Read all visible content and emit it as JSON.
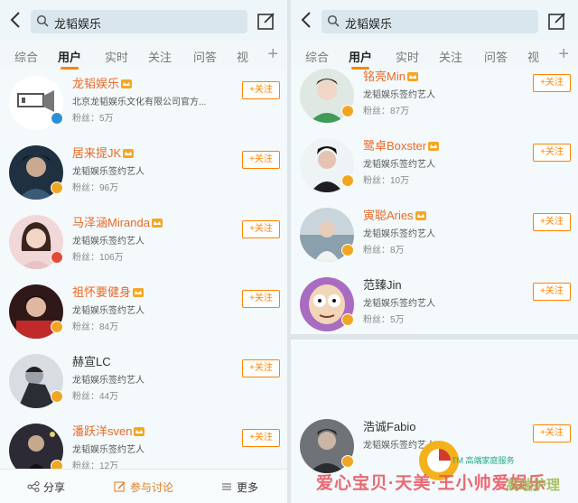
{
  "search": {
    "query": "龙韬娱乐"
  },
  "tabs_left": [
    "综合",
    "用户",
    "实时",
    "关注",
    "问答",
    "视"
  ],
  "tabs_right": [
    "综合",
    "用户",
    "实时",
    "关注",
    "问答",
    "视"
  ],
  "colors": {
    "accent": "#ff8200",
    "name_orange": "#e86b2a",
    "verified_blue": "#2b8fd8",
    "verified_gold": "#f1a623",
    "verified_red": "#e24b3a"
  },
  "follow_label": "+关注",
  "left_users": [
    {
      "name": "龙韬娱乐",
      "crown": true,
      "desc": "北京龙韬娱乐文化有限公司官方...",
      "fans": "粉丝：5万",
      "badge": "blue",
      "avatar": "logo"
    },
    {
      "name": "居来提JK",
      "crown": true,
      "desc": "龙韬娱乐签约艺人",
      "fans": "粉丝：96万",
      "badge": "gold",
      "avatar": "dark"
    },
    {
      "name": "马泽涵Miranda",
      "crown": true,
      "desc": "龙韬娱乐签约艺人",
      "fans": "粉丝：106万",
      "badge": "red",
      "avatar": "pink"
    },
    {
      "name": "祖怀要健身",
      "crown": true,
      "desc": "龙韬娱乐签约艺人",
      "fans": "粉丝：84万",
      "badge": "gold",
      "avatar": "red"
    },
    {
      "name": "赫宣LC",
      "crown": false,
      "desc": "龙韬娱乐签约艺人",
      "fans": "粉丝：44万",
      "badge": "gold",
      "avatar": "bw"
    },
    {
      "name": "潘跃洋sven",
      "crown": true,
      "desc": "龙韬娱乐签约艺人",
      "fans": "粉丝：12万",
      "badge": "gold",
      "avatar": "night"
    }
  ],
  "right_users": [
    {
      "name": "铭亮Min",
      "crown": true,
      "desc": "龙韬娱乐签约艺人",
      "fans": "粉丝：87万",
      "badge": "gold",
      "avatar": "green"
    },
    {
      "name": "鹭卓Boxster",
      "crown": true,
      "desc": "龙韬娱乐签约艺人",
      "fans": "粉丝：10万",
      "badge": "gold",
      "avatar": "sky"
    },
    {
      "name": "寅聪Aries",
      "crown": true,
      "desc": "龙韬娱乐签约艺人",
      "fans": "粉丝：8万",
      "badge": "gold",
      "avatar": "room"
    },
    {
      "name": "范臻Jin",
      "crown": false,
      "desc": "龙韬娱乐签约艺人",
      "fans": "粉丝：5万",
      "badge": "gold",
      "avatar": "cartoon"
    },
    {
      "name": "浩诚Fabio",
      "crown": false,
      "desc": "龙韬娱乐签约艺人",
      "fans": "",
      "badge": "gold",
      "avatar": "gray"
    }
  ],
  "bottom": {
    "share": "分享",
    "discuss": "参与讨论",
    "more": "更多"
  },
  "watermark": {
    "text": "爱心宝贝·天美·王小帅爱娱乐",
    "tm": "TM 高端家庭服务",
    "cn": "高端护理"
  }
}
